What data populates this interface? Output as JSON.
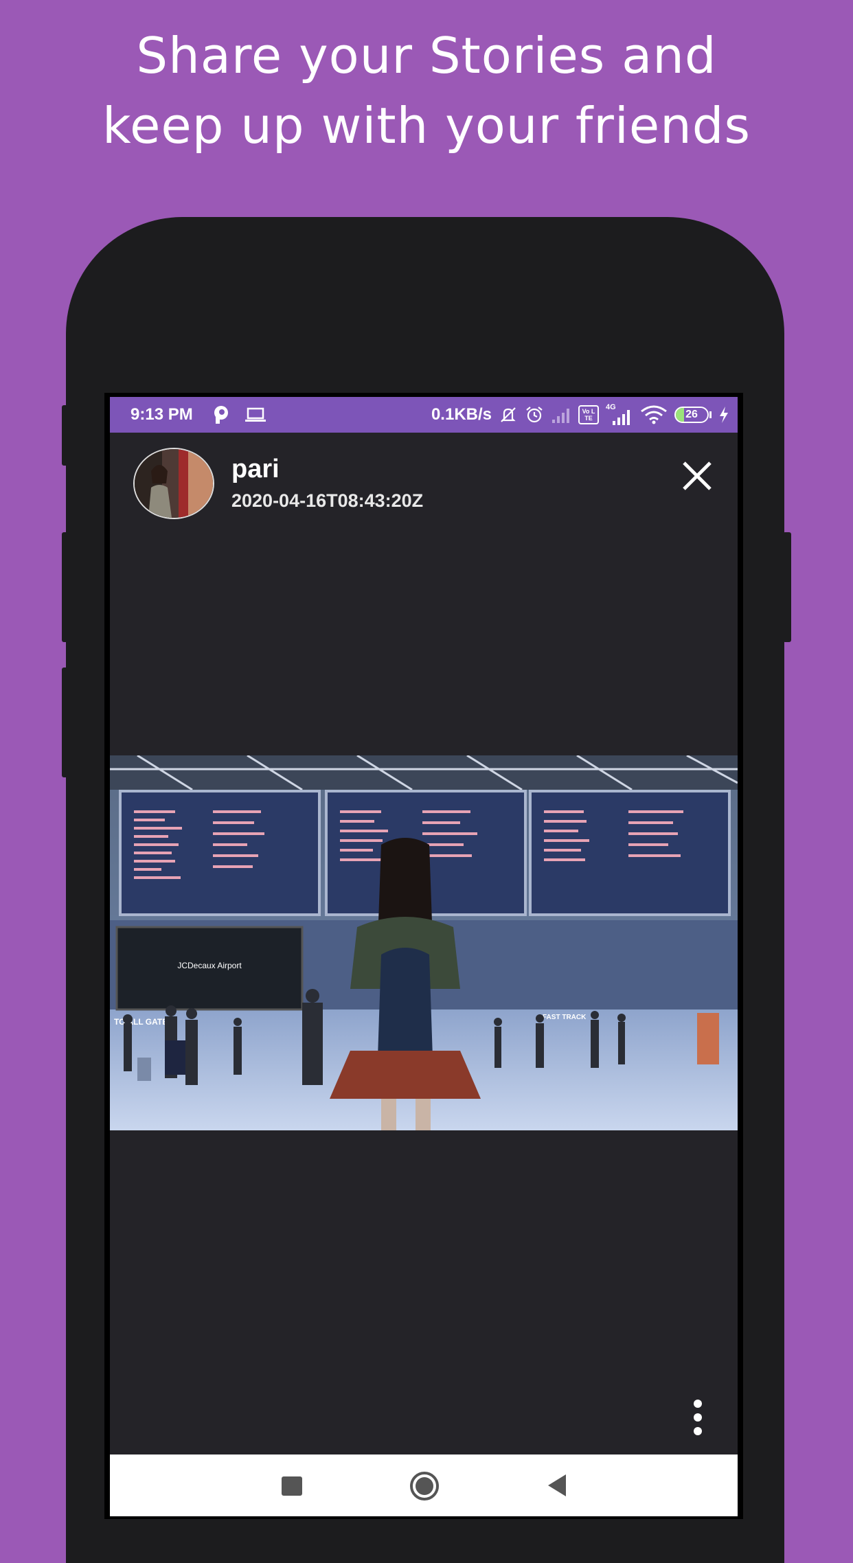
{
  "promo": {
    "headline_line1": "Share your Stories and",
    "headline_line2": "keep up with your friends"
  },
  "colors": {
    "background": "#9b59b6",
    "phone_body": "#1c1c1e",
    "status_bar": "#7d55b8",
    "story_bg": "#242328"
  },
  "status_bar": {
    "time": "9:13 PM",
    "network_speed": "0.1KB/s",
    "network_type": "4G",
    "volte_label": "Vo LTE",
    "battery_level": "26",
    "icons": [
      "p-app-icon",
      "laptop-icon",
      "silent-icon",
      "alarm-icon",
      "signal-icon",
      "volte-icon",
      "4g-signal-icon",
      "wifi-icon",
      "battery-icon",
      "charging-icon"
    ]
  },
  "story": {
    "username": "pari",
    "timestamp": "2020-04-16T08:43:20Z",
    "photo_sign_text": "JCDecaux Airport",
    "photo_gate_text": "TO ALL GATES",
    "photo_fast_track_text": "FAST TRACK"
  },
  "nav_bar": {
    "buttons": [
      "recents-button",
      "home-button",
      "back-button"
    ]
  }
}
